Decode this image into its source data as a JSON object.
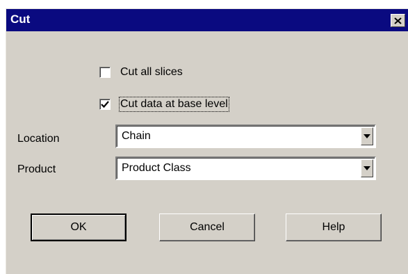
{
  "window": {
    "title": "Cut",
    "close_icon": "close-icon"
  },
  "options": {
    "cut_all_slices": {
      "label": "Cut all slices",
      "checked": false
    },
    "cut_base_level": {
      "label": "Cut data at base level",
      "checked": true
    }
  },
  "fields": {
    "location": {
      "label": "Location",
      "value": "Chain",
      "arrow_icon": "chevron-down-icon"
    },
    "product": {
      "label": "Product",
      "value": "Product Class",
      "arrow_icon": "chevron-down-icon"
    }
  },
  "buttons": {
    "ok": "OK",
    "cancel": "Cancel",
    "help": "Help"
  },
  "colors": {
    "titlebar": "#0a0a80",
    "dialog_bg": "#d4d0c8"
  }
}
